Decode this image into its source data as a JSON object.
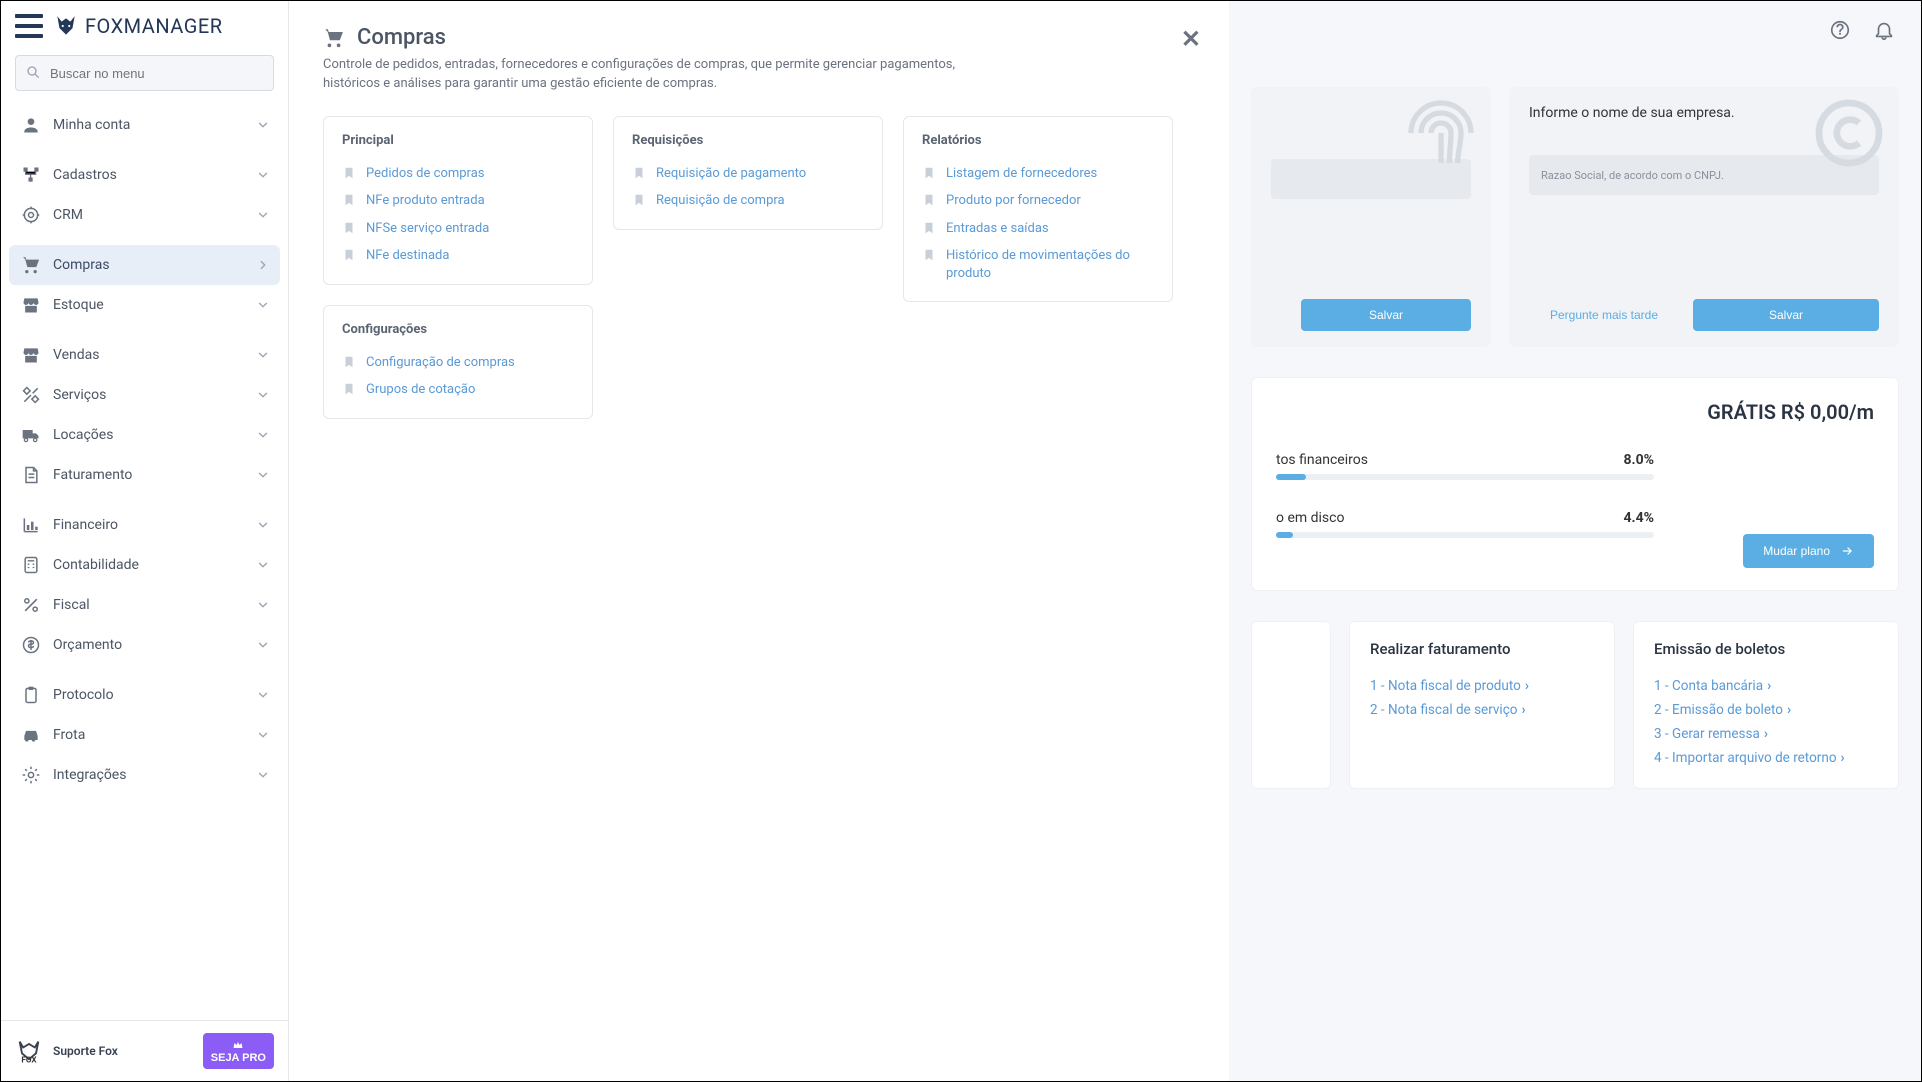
{
  "brand": {
    "name": "FOX",
    "sub": "MANAGER"
  },
  "search": {
    "placeholder": "Buscar no menu"
  },
  "nav": {
    "items": [
      {
        "label": "Minha conta"
      },
      {
        "label": "Cadastros"
      },
      {
        "label": "CRM"
      },
      {
        "label": "Compras"
      },
      {
        "label": "Estoque"
      },
      {
        "label": "Vendas"
      },
      {
        "label": "Serviços"
      },
      {
        "label": "Locações"
      },
      {
        "label": "Faturamento"
      },
      {
        "label": "Financeiro"
      },
      {
        "label": "Contabilidade"
      },
      {
        "label": "Fiscal"
      },
      {
        "label": "Orçamento"
      },
      {
        "label": "Protocolo"
      },
      {
        "label": "Frota"
      },
      {
        "label": "Integrações"
      }
    ]
  },
  "sidebarFooter": {
    "support": "Suporte Fox",
    "pro": "SEJA PRO"
  },
  "flyout": {
    "title": "Compras",
    "desc": "Controle de pedidos, entradas, fornecedores e configurações de compras, que permite gerenciar pagamentos, históricos e análises para garantir uma gestão eficiente de compras.",
    "sections": {
      "principal": {
        "title": "Principal",
        "links": [
          "Pedidos de compras",
          "NFe produto entrada",
          "NFSe serviço entrada",
          "NFe destinada"
        ]
      },
      "config": {
        "title": "Configurações",
        "links": [
          "Configuração de compras",
          "Grupos de cotação"
        ]
      },
      "req": {
        "title": "Requisições",
        "links": [
          "Requisição de pagamento",
          "Requisição de compra"
        ]
      },
      "rel": {
        "title": "Relatórios",
        "links": [
          "Listagem de fornecedores",
          "Produto por fornecedor",
          "Entradas e saídas",
          "Histórico de movimentações do produto"
        ]
      }
    }
  },
  "dash": {
    "card1": {
      "save": "Salvar"
    },
    "card2": {
      "title": "Informe o nome de sua empresa.",
      "placeholder": "Razao Social, de acordo com o CNPJ.",
      "later": "Pergunte mais tarde",
      "save": "Salvar"
    },
    "plan": {
      "price": "GRÁTIS R$ 0,00/m",
      "m1_label": "tos financeiros",
      "m1_value": "8.0%",
      "m2_label": "o em disco",
      "m2_value": "4.4%",
      "change": "Mudar plano"
    },
    "wiz1": {
      "title": "Realizar faturamento",
      "steps": [
        "1 - Nota fiscal de produto",
        "2 - Nota fiscal de serviço"
      ]
    },
    "wiz2": {
      "title": "Emissão de boletos",
      "steps": [
        "1 - Conta bancária",
        "2 - Emissão de boleto",
        "3 - Gerar remessa",
        "4 - Importar arquivo de retorno"
      ]
    }
  }
}
